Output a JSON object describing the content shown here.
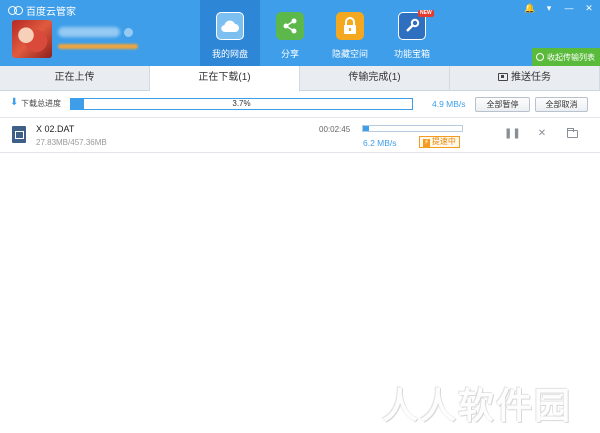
{
  "app": {
    "title": "百度云管家"
  },
  "window_controls": [
    {
      "name": "skin-icon",
      "glyph": "🔔"
    },
    {
      "name": "menu-icon",
      "glyph": "▾"
    },
    {
      "name": "minimize-icon",
      "glyph": "—"
    },
    {
      "name": "close-icon",
      "glyph": "✕"
    }
  ],
  "header": {
    "nav": [
      {
        "label": "我的网盘",
        "icon": "cloud-icon",
        "active": true
      },
      {
        "label": "分享",
        "icon": "share-icon",
        "active": false
      },
      {
        "label": "隐藏空间",
        "icon": "lock-icon",
        "active": false
      },
      {
        "label": "功能宝箱",
        "icon": "toolbox-icon",
        "active": false,
        "badge": "NEW"
      }
    ],
    "collapse_label": "收起传输列表"
  },
  "tabs": [
    {
      "label": "正在上传",
      "active": false
    },
    {
      "label": "正在下载(1)",
      "active": true
    },
    {
      "label": "传输完成(1)",
      "active": false
    },
    {
      "label": "推送任务",
      "active": false,
      "icon": "push-icon"
    }
  ],
  "total": {
    "label": "下载总进度",
    "percent_text": "3.7%",
    "progress": 0.037,
    "speed": "4.9 MB/s",
    "pause_all": "全部暂停",
    "cancel_all": "全部取消"
  },
  "tasks": [
    {
      "name": "X  02.DAT",
      "size": "27.83MB/457.36MB",
      "time_left": "00:02:45",
      "progress": 0.061,
      "speed": "6.2 MB/s",
      "speedup_label": "提速中",
      "bolt": "⚡",
      "pause_glyph": "❚❚",
      "cancel_glyph": "✕"
    }
  ],
  "watermark": "人人软件园",
  "colors": {
    "header": "#3e9ee9",
    "header_active": "#2d86d6",
    "accent": "#3e9ee9",
    "green": "#5aba3b",
    "orange": "#f39c1f"
  }
}
